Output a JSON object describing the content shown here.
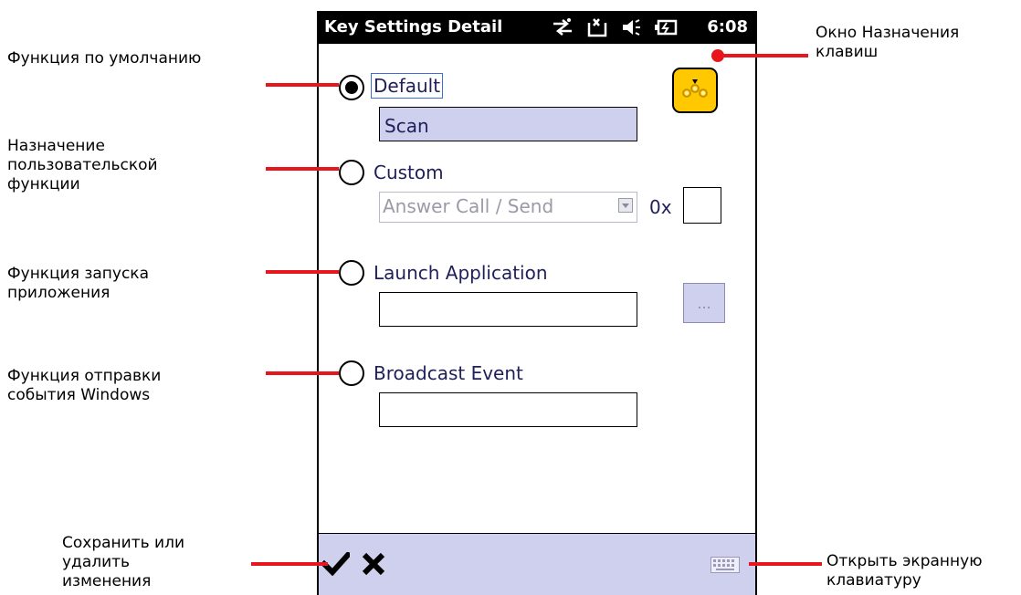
{
  "window": {
    "title": "Key Settings Detail",
    "time": "6:08"
  },
  "options": {
    "default": {
      "label": "Default",
      "value": "Scan",
      "checked": true
    },
    "custom": {
      "label": "Custom",
      "combo_value": "Answer Call / Send",
      "hex_prefix": "0x",
      "hex_value": ""
    },
    "launch": {
      "label": "Launch Application",
      "path_value": "",
      "browse_label": "..."
    },
    "broadcast": {
      "label": "Broadcast Event",
      "event_value": ""
    }
  },
  "annotations": {
    "default_function": "Функция по умолчанию",
    "custom_function": "Назначение\nпользовательской\nфункции",
    "launch_function": "Функция запуска\nприложения",
    "broadcast_function": "Функция отправки\nсобытия Windows",
    "save_or_discard": "Сохранить или\nудалить\nизменения",
    "key_assignment_window": "Окно Назначения\nклавиш",
    "open_keyboard": "Открыть экранную\nклавиатуру"
  },
  "icons": {
    "sync": "sync-arrows-icon",
    "connection": "connection-icon",
    "volume": "speaker-mute-icon",
    "battery": "battery-charging-icon",
    "menu": "menu-dots-icon",
    "ok": "checkmark-icon",
    "cancel": "x-close-icon",
    "keyboard": "keyboard-icon"
  },
  "colors": {
    "accent_red": "#e8161c",
    "field_fill": "#cfcfee",
    "menu_button": "#ffc800"
  }
}
